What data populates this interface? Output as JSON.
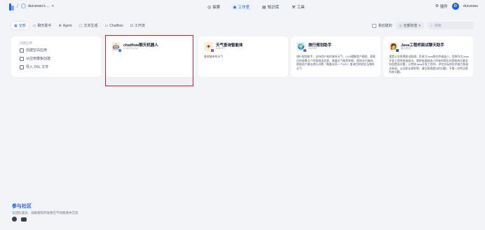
{
  "header": {
    "workspace_name": "durunwu's ...",
    "nav": [
      {
        "label": "探索",
        "icon": "compass-icon"
      },
      {
        "label": "工作室",
        "icon": "studio-icon",
        "active": true
      },
      {
        "label": "知识库",
        "icon": "book-icon"
      },
      {
        "label": "工具",
        "icon": "tools-icon"
      }
    ],
    "plugin_label": "插件",
    "avatar_letter": "D",
    "user_name": "durunwu"
  },
  "filters": {
    "tabs": [
      {
        "label": "全部",
        "active": true
      },
      {
        "label": "聊天助手"
      },
      {
        "label": "Agent"
      },
      {
        "label": "文本生成"
      },
      {
        "label": "Chatflow"
      },
      {
        "label": "工作流"
      }
    ],
    "created_by_me_label": "我创建的",
    "tags_label": "全部标签",
    "search_placeholder": "搜索"
  },
  "create_card": {
    "title": "创建应用",
    "items": [
      {
        "label": "创建空白应用"
      },
      {
        "label": "从应用模板创建"
      },
      {
        "label": "导入 DSL 文件"
      }
    ]
  },
  "apps": [
    {
      "name": "chatflow聊天机器人",
      "type": "CHATFLOW",
      "description": "",
      "icon_bg": "#ffeadb",
      "badge_color": "#2e90fa"
    },
    {
      "name": "天气查询智能体",
      "type": "AGENT",
      "description": "查询城市的天气",
      "icon_bg": "#ffedd5",
      "badge_color": "#7a5af8"
    },
    {
      "name": "旅行规划助手",
      "type": "AGENT",
      "description": "旅行规划助手，支持用户询问城市天气、LLM理解用户意图、获取目的地景点介绍和相关信息，根据天气推荐穿搭，规划出行路线，帮助用户做出旅行决策（需要访问一个API）查询目的地及当地的天气",
      "icon_bg": "#e0f2fe",
      "badge_color": "#7a5af8"
    },
    {
      "name": "Java工程师面试聊天助手",
      "type": "聊天助手",
      "description": "我是公司招聘面试助理，负责为Java岗位的候选人，您将作为Java开发工程师参加面试，我将依据候选人所有的简历内容和岗位要求向您提出问题，以考核Java开发工程师，评估实际的技术能力和面试表现，以及职业规划等，请回答我提出的问题，不要一次性回答所有问题。",
      "icon_bg": "#fce7d6",
      "badge_color": "#155eef"
    }
  ],
  "community": {
    "title": "参与社区",
    "description": "与团队成员、贡献者和开发者在不同频道中交流"
  }
}
